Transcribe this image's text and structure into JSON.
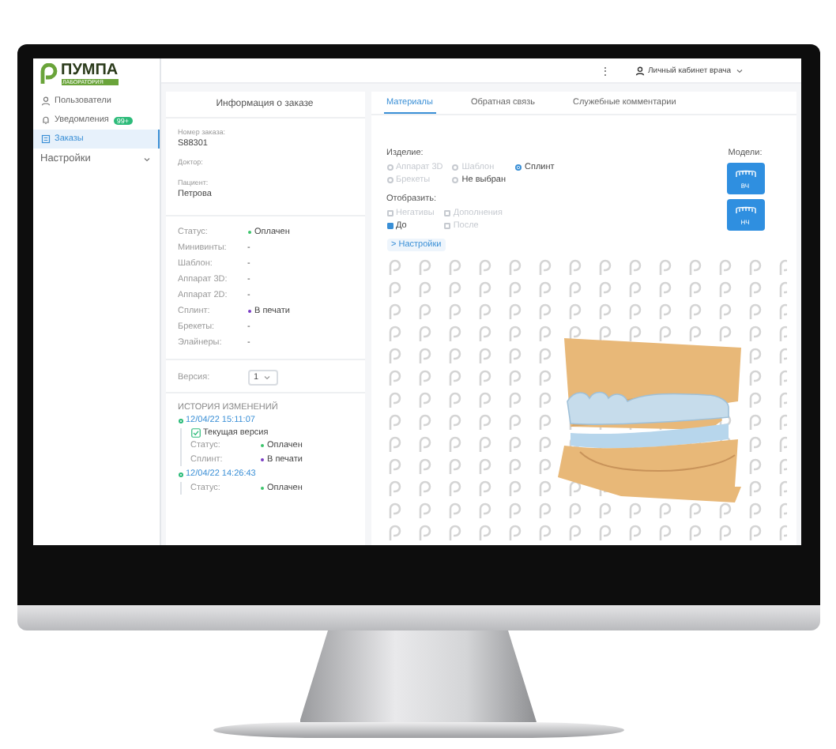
{
  "logo": {
    "name": "ПУМПА",
    "subtitle": "ЛАБОРАТОРИЯ"
  },
  "sidebar": {
    "items": [
      {
        "label": "Пользователи",
        "kind": "users",
        "selected": false
      },
      {
        "label": "Уведомления",
        "kind": "bell",
        "badge": "99+",
        "selected": false
      },
      {
        "label": "Заказы",
        "kind": "orders",
        "selected": true
      },
      {
        "label": "Настройки",
        "kind": "group",
        "selected": false
      }
    ]
  },
  "top_bar": {
    "menu": "⋮",
    "account": "Личный кабинет врача"
  },
  "order_info": {
    "title": "Информация о заказе",
    "fields": [
      {
        "label": "Номер заказа:",
        "value": "S88301"
      },
      {
        "label": "Доктор:"
      },
      {
        "label": "Пациент:",
        "value": "Петрова"
      }
    ],
    "statuses": [
      {
        "label": "Статус:",
        "value": "Оплачен",
        "color": "#3cc46b"
      },
      {
        "label": "Минивинты:",
        "value": "-"
      },
      {
        "label": "Шаблон:",
        "value": "-"
      },
      {
        "label": "Аппарат 3D:",
        "value": "-"
      },
      {
        "label": "Аппарат 2D:",
        "value": "-"
      },
      {
        "label": "Сплинт:",
        "value": "В печати",
        "color": "#7a3cc4"
      },
      {
        "label": "Брекеты:",
        "value": "-"
      },
      {
        "label": "Элайнеры:",
        "value": "-"
      }
    ],
    "version": {
      "label": "Версия:",
      "value": "1"
    },
    "history": {
      "title": "ИСТОРИЯ ИЗМЕНЕНИЙ",
      "entries": [
        {
          "time": "12/04/22 15:11:07",
          "current": "Текущая версия",
          "rows": [
            {
              "label": "Статус:",
              "value": "Оплачен",
              "color": "#3cc46b"
            },
            {
              "label": "Сплинт:",
              "value": "В печати",
              "color": "#7a3cc4"
            }
          ]
        },
        {
          "time": "12/04/22 14:26:43",
          "rows": [
            {
              "label": "Статус:",
              "value": "Оплачен",
              "color": "#3cc46b"
            }
          ]
        }
      ]
    }
  },
  "tabs": [
    {
      "label": "Материалы",
      "selected": true
    },
    {
      "label": "Обратная связь",
      "selected": false
    },
    {
      "label": "Служебные комментарии",
      "selected": false
    }
  ],
  "product": {
    "label": "Изделие:",
    "options": [
      {
        "label": "Аппарат 3D",
        "selected": false,
        "disabled": true
      },
      {
        "label": "Шаблон",
        "selected": false,
        "disabled": true
      },
      {
        "label": "Сплинт",
        "selected": true,
        "disabled": false
      },
      {
        "label": "Брекеты",
        "selected": false,
        "disabled": true
      },
      {
        "label": "Не выбран",
        "selected": false,
        "disabled": false
      }
    ]
  },
  "display": {
    "label": "Отобразить:",
    "options": [
      {
        "label": "Негативы",
        "checked": false,
        "disabled": true
      },
      {
        "label": "Дополнения",
        "checked": false,
        "disabled": true
      },
      {
        "label": "До",
        "checked": true,
        "disabled": false
      },
      {
        "label": "После",
        "checked": false,
        "disabled": true
      }
    ]
  },
  "settings_link": "> Настройки",
  "models": {
    "label": "Модели:",
    "buttons": [
      "ВЧ",
      "НЧ"
    ]
  }
}
